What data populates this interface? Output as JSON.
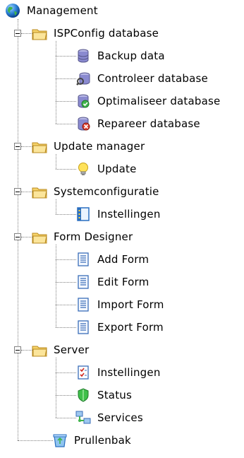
{
  "root": {
    "label": "Management",
    "icon": "globe-icon"
  },
  "groups": [
    {
      "label": "ISPConfig database",
      "icon": "folder-icon",
      "items": [
        {
          "label": "Backup data",
          "icon": "database-icon"
        },
        {
          "label": "Controleer database",
          "icon": "database-check-icon"
        },
        {
          "label": "Optimaliseer database",
          "icon": "database-optimize-icon"
        },
        {
          "label": "Repareer database",
          "icon": "database-repair-icon"
        }
      ]
    },
    {
      "label": "Update manager",
      "icon": "folder-icon",
      "items": [
        {
          "label": "Update",
          "icon": "lightbulb-icon"
        }
      ]
    },
    {
      "label": "Systemconfiguratie",
      "icon": "folder-icon",
      "items": [
        {
          "label": "Instellingen",
          "icon": "settings-panel-icon"
        }
      ]
    },
    {
      "label": "Form Designer",
      "icon": "folder-icon",
      "items": [
        {
          "label": "Add Form",
          "icon": "form-icon"
        },
        {
          "label": "Edit Form",
          "icon": "form-icon"
        },
        {
          "label": "Import Form",
          "icon": "form-icon"
        },
        {
          "label": "Export Form",
          "icon": "form-icon"
        }
      ]
    },
    {
      "label": "Server",
      "icon": "folder-icon",
      "items": [
        {
          "label": "Instellingen",
          "icon": "checklist-icon"
        },
        {
          "label": "Status",
          "icon": "shield-icon"
        },
        {
          "label": "Services",
          "icon": "network-icon"
        }
      ]
    }
  ],
  "trash": {
    "label": "Prullenbak",
    "icon": "recycle-bin-icon"
  }
}
